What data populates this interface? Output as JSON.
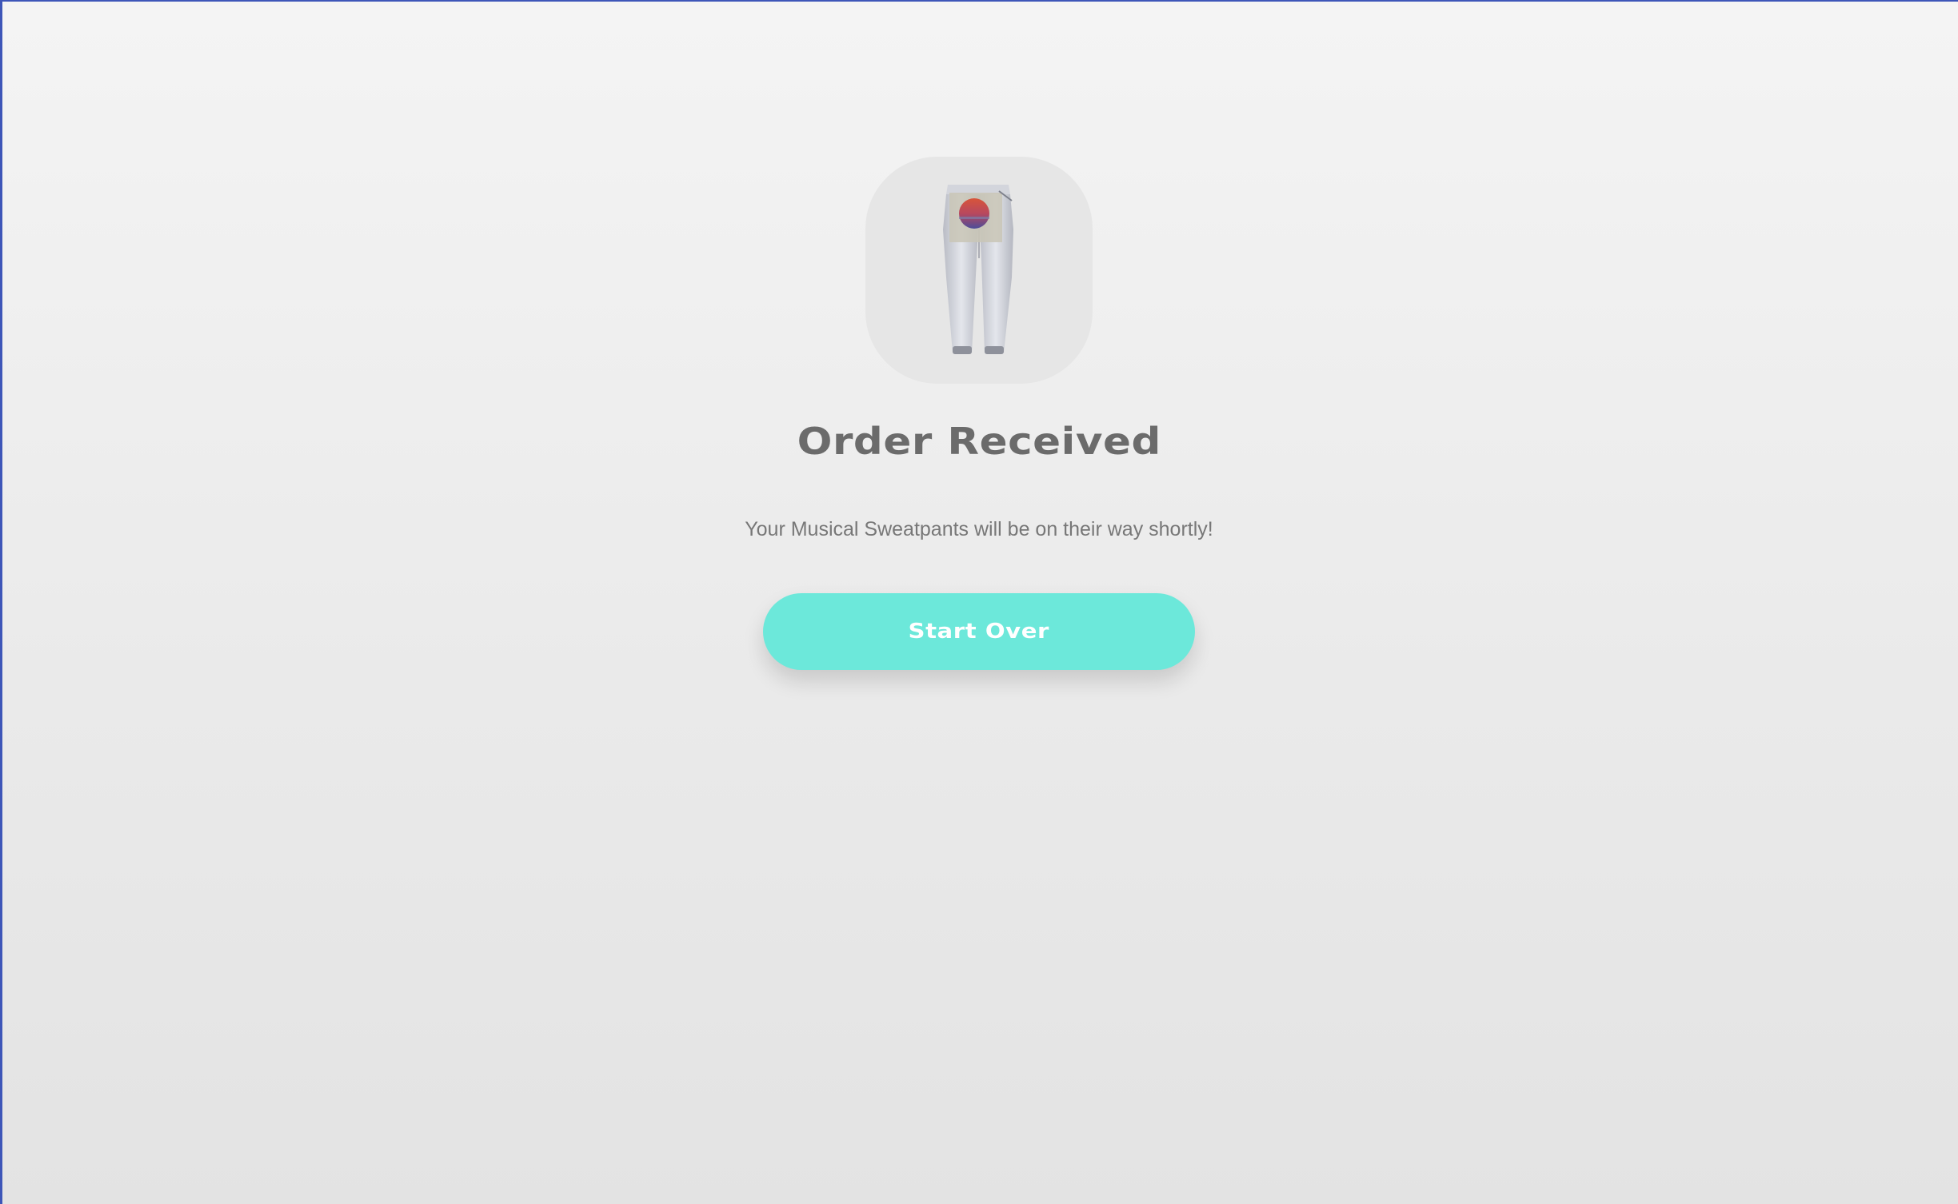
{
  "product": {
    "image_icon": "sweatpants-product-image"
  },
  "confirmation": {
    "title": "Order Received",
    "message": "Your Musical Sweatpants will be on their way shortly!"
  },
  "actions": {
    "start_over_label": "Start Over"
  },
  "colors": {
    "accent": "#6ce8da",
    "title_text": "#6b6b6b",
    "body_text": "#777777",
    "tile_background": "#e6e6e6"
  }
}
